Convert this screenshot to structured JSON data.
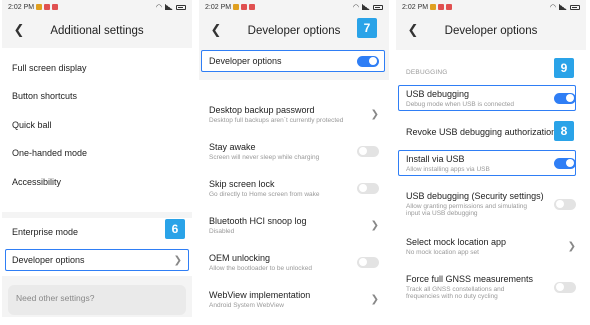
{
  "status_time": "2:02 PM",
  "panel1": {
    "title": "Additional settings",
    "items": [
      {
        "label": "Full screen display"
      },
      {
        "label": "Button shortcuts"
      },
      {
        "label": "Quick ball"
      },
      {
        "label": "One-handed mode"
      },
      {
        "label": "Accessibility"
      },
      {
        "label": "Enterprise mode"
      },
      {
        "label": "Developer options"
      }
    ],
    "card_text": "Need other settings?",
    "badge": "6"
  },
  "panel2": {
    "title": "Developer options",
    "badge": "7",
    "items": [
      {
        "label": "Developer options",
        "sub": "",
        "control": "toggle-on"
      },
      {
        "label": "Desktop backup password",
        "sub": "Desktop full backups aren`t currently protected",
        "control": "chevron"
      },
      {
        "label": "Stay awake",
        "sub": "Screen will never sleep while charging",
        "control": "toggle-off"
      },
      {
        "label": "Skip screen lock",
        "sub": "Go directly to Home screen from wake",
        "control": "toggle-off"
      },
      {
        "label": "Bluetooth HCI snoop log",
        "sub": "Disabled",
        "control": "chevron"
      },
      {
        "label": "OEM unlocking",
        "sub": "Allow the bootloader to be unlocked",
        "control": "toggle-off"
      },
      {
        "label": "WebView implementation",
        "sub": "Android System WebView",
        "control": "chevron"
      }
    ]
  },
  "panel3": {
    "title": "Developer options",
    "section": "DEBUGGING",
    "badge_usb": "9",
    "badge_install": "8",
    "items": [
      {
        "label": "USB debugging",
        "sub": "Debug mode when USB is connected",
        "control": "toggle-on"
      },
      {
        "label": "Revoke USB debugging authorizations",
        "sub": "",
        "control": "none"
      },
      {
        "label": "Install via USB",
        "sub": "Allow installing apps via USB",
        "control": "toggle-on"
      },
      {
        "label": "USB debugging (Security settings)",
        "sub": "Allow granting permissions and simulating",
        "sub2": "input via USB debugging",
        "control": "toggle-off"
      },
      {
        "label": "Select mock location app",
        "sub": "No mock location app set",
        "control": "chevron"
      },
      {
        "label": "Force full GNSS measurements",
        "sub": "Track all GNSS constellations and",
        "sub2": "frequencies with no duty cycling",
        "control": "toggle-off"
      }
    ]
  },
  "colors": {
    "accent": "#2f7ef5",
    "badge": "#2aa3e8"
  }
}
